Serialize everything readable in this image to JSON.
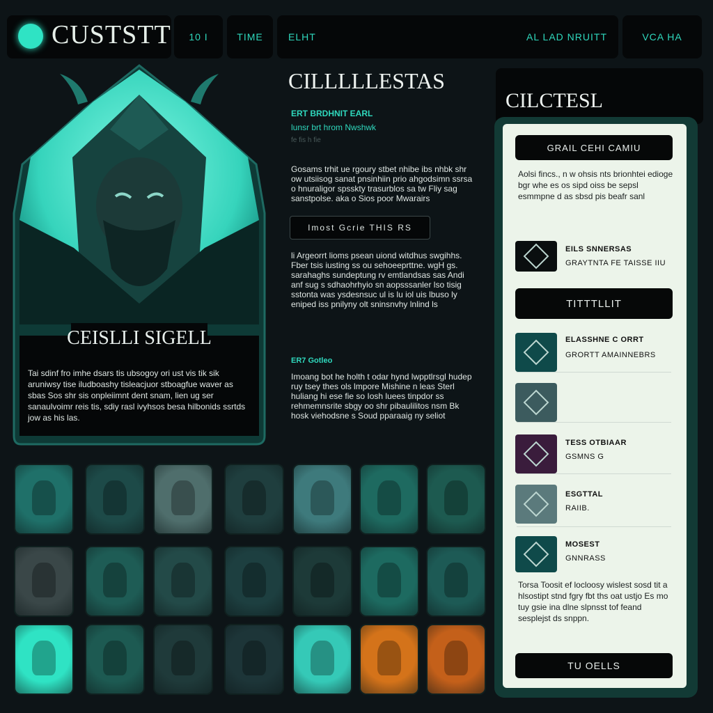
{
  "header": {
    "logo_text": "CUSTSTT",
    "nav": [
      "10 I",
      "TIME",
      "ELHT",
      "AL LAD NRUITT",
      "VCA HA"
    ]
  },
  "hero": {
    "name": "CEISLLI SIGELL",
    "description": "Tai sdinf fro imhe dsars tis ubsogoy ori ust vis tik sik aruniwsy tise iludboashy tisleacjuor stboagfue waver as sbas Sos shr sis onpleiimnt dent snam, lien ug ser sanaulvoimr reis tis, sdiy rasl ivyhsos besa hilbonids ssrtds jow as his las."
  },
  "middle": {
    "title": "CILLLLLESTAS",
    "subtitle1": "ERT BRDHNIT EARL",
    "subtitle2": "lunsr brt hrom Nwshwk",
    "subtitle3": "fe fis h fie",
    "para1": "Gosams trhit ue rgoury stbet nhibe ibs nhbk shr ow utsiisog sanat pnsinhiin prio ahgodsimn ssrsa o hnuraligor spsskty trasurblos sa tw Fliy sag sanstpolse. aka o Sios poor Mwarairs",
    "button": "Imost Gcrie THIS RS",
    "para2": "li Argeorrt lioms psean uiond witdhus swgihhs. Fber tsis iusting ss ou sehoeeprttne. wgH gs. sarahaghs sundeptung rv emtlandsas sas Andi anf sug s sdhaohrhyio sn aopsssanler lso tisig sstonta was ysdesnsuc ul is lu iol uis lbuso ly eniped iss pnilyny olt sninsnvhy lnlind ls",
    "subtitle4": "ER7 Gotleo",
    "para3": "Imoang bot he holth t odar hynd lwpptlrsgl hudep ruy tsey thes ols lmpore Mishine n leas Sterl huliang hi ese fie so Iosh luees tinpdor ss rehmemnsrite sbgy oo shr pibaulilitos nsm Bk hosk viehodsne s Soud pparaaig ny seliot"
  },
  "right_panel": {
    "title": "CILCTESL",
    "button1": "GRAIL CEHI CAMIU",
    "para1": "Aolsi fincs., n w ohsis nts brionhtei edioge bgr whe es os sipd oiss be sepsl esmmpne d as sbsd pis beafr sanl",
    "items": [
      {
        "line1": "EILS SNNERSAS",
        "line2": "GRAYTNTA FE TAISSE IIU",
        "color": "#0a0e0f"
      },
      {
        "line1": "",
        "line2": "",
        "color": "#0a0e0f"
      },
      {
        "line1": "ELASSHNE C ORRT",
        "line2": "GRORTT AMAINNEBRS",
        "color": "#0f4a4a"
      },
      {
        "line1": "",
        "line2": "",
        "color": "#3c5b5e"
      },
      {
        "line1": "TESS OTBIAAR",
        "line2": "GSMNS G",
        "color": "#3a1c3c"
      },
      {
        "line1": "ESGTTAL",
        "line2": "RAIIB.",
        "color": "#5b7a7c"
      },
      {
        "line1": "MOSEST",
        "line2": "GNNRASS",
        "color": "#0f4a4a"
      }
    ],
    "button2": "TITTTLLIT",
    "para2": "Torsa Toosit ef locloosy wislest sosd tit a hlsostipt stnd fgry fbt ths oat ustjo Es mo tuy gsie ina dlne slpnsst tof feand sesplejst ds snppn.",
    "button3": "TU OELLS"
  },
  "grid": {
    "tile_colors": [
      [
        "#1f7069",
        "#1d4a48",
        "#4f6e6c",
        "#1f3e3e",
        "#3e7a7c",
        "#1e6a60",
        "#1d5a50"
      ],
      [
        "#3a4748",
        "#1e5c55",
        "#234a48",
        "#1d3f40",
        "#1d3a38",
        "#1d6a60",
        "#1d5a55"
      ],
      [
        "#2fe3c4",
        "#1d5a52",
        "#1f3a3a",
        "#1d3538",
        "#35c9b7",
        "#d4731a",
        "#c4601a"
      ]
    ]
  }
}
